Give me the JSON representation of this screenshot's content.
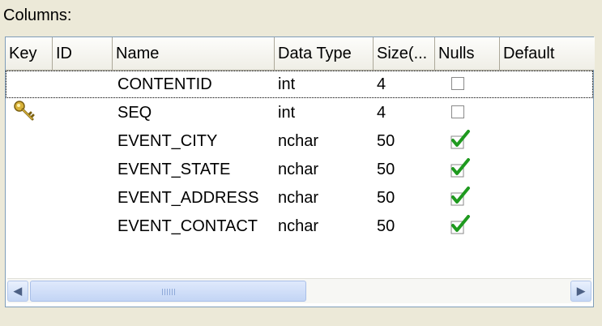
{
  "section_label": "Columns:",
  "headers": [
    "Key",
    "ID",
    "Name",
    "Data Type",
    "Size(...",
    "Nulls",
    "Default"
  ],
  "rows": [
    {
      "key": false,
      "id": "",
      "name": "CONTENTID",
      "type": "int",
      "size": "4",
      "nulls": false
    },
    {
      "key": true,
      "id": "",
      "name": "SEQ",
      "type": "int",
      "size": "4",
      "nulls": false
    },
    {
      "key": false,
      "id": "",
      "name": "EVENT_CITY",
      "type": "nchar",
      "size": "50",
      "nulls": true
    },
    {
      "key": false,
      "id": "",
      "name": "EVENT_STATE",
      "type": "nchar",
      "size": "50",
      "nulls": true
    },
    {
      "key": false,
      "id": "",
      "name": "EVENT_ADDRESS",
      "type": "nchar",
      "size": "50",
      "nulls": true
    },
    {
      "key": false,
      "id": "",
      "name": "EVENT_CONTACT",
      "type": "nchar",
      "size": "50",
      "nulls": true
    }
  ],
  "colors": {
    "check": "#1f9a1f",
    "key_gold": "#d8b23a"
  },
  "icons": {
    "key": "key-icon",
    "check": "checkmark-icon",
    "scroll_left": "arrow-left-icon",
    "scroll_right": "arrow-right-icon"
  }
}
